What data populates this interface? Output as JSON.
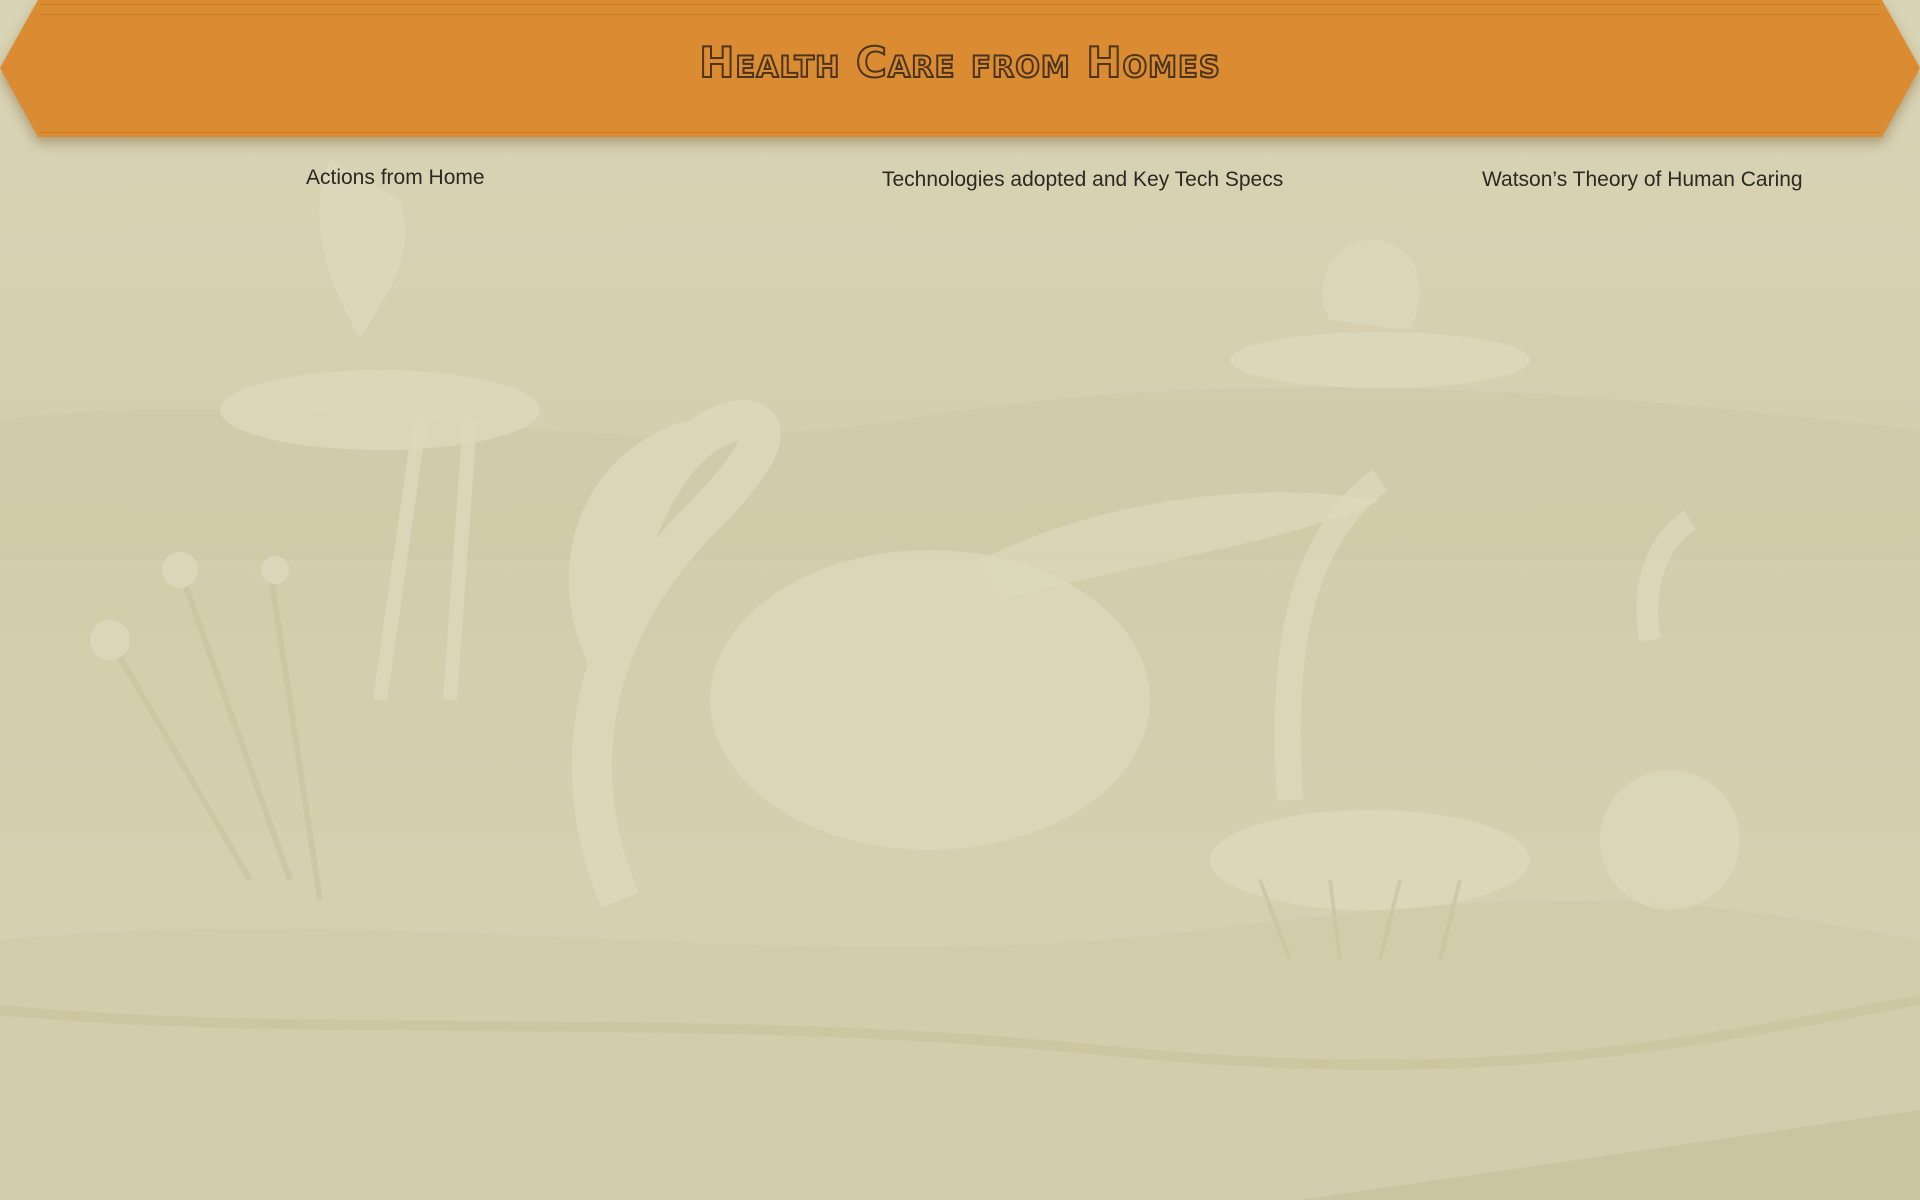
{
  "page": {
    "title": "Health Care from Homes",
    "background_color": "#d6d1b2",
    "banner_color": "#db8b32",
    "title_outline_color": "#4b3520"
  },
  "nav": {
    "items": [
      {
        "label": "Actions from Home"
      },
      {
        "label": "Technologies adopted and Key Tech Specs"
      },
      {
        "label": "Watson’s Theory of Human Caring"
      }
    ]
  }
}
